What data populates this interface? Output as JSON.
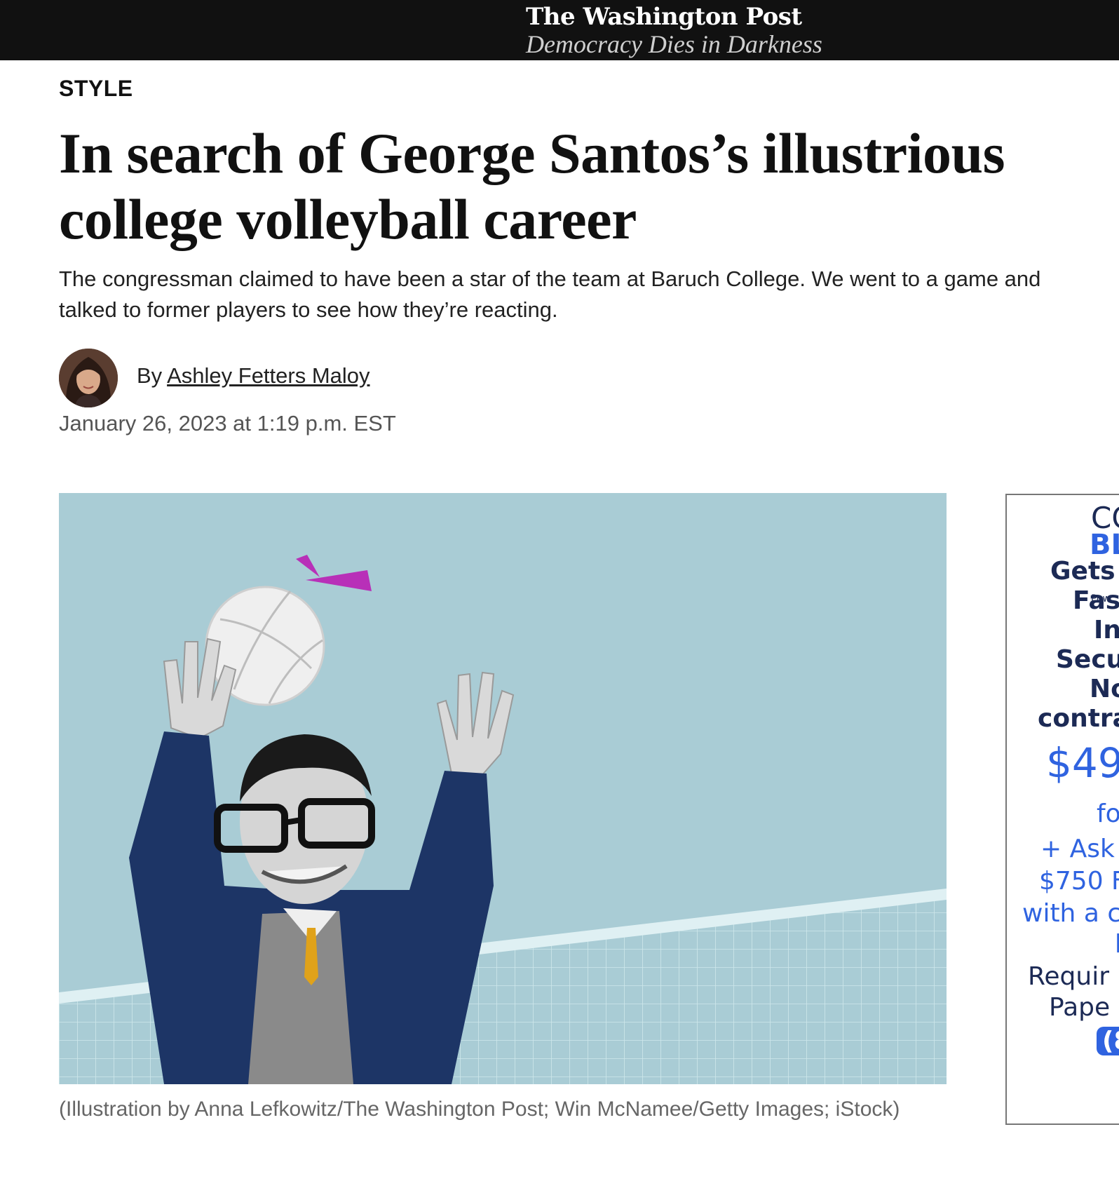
{
  "header": {
    "masthead": "The Washington Post",
    "tagline": "Democracy Dies in Darkness",
    "background_color": "#111111"
  },
  "article": {
    "section": "STYLE",
    "headline_line1": "In search of George Santos’s illustrious",
    "headline_line2": "college volleyball career",
    "dek": "The congressman claimed to have been a star of the team at Baruch College. We went to a game and talked to former players to see how they’re reacting.",
    "byline_prefix": "By",
    "author": "Ashley Fetters Maloy",
    "date": "January 26, 2023 at 1:19 p.m. EST",
    "image_caption": "(Illustration by Anna Lefkowitz/The Washington Post; Win McNamee/Getty Images; iStock)"
  },
  "ad": {
    "lines": [
      "CO",
      "BL",
      "Gets",
      "Pow",
      "Fas",
      "In",
      "Secu",
      "No",
      "contra",
      "$49",
      "fo",
      "+ Ask",
      "$750 F",
      "with a c",
      "b",
      "Requir",
      "Pape",
      "(8"
    ],
    "brand_color": "#2f63e0",
    "text_color": "#1c2a55"
  },
  "colors": {
    "hero_background": "#a9ccd5",
    "accent_magenta": "#b830b8",
    "suit_navy": "#1d3566",
    "tie_gold": "#e0a21a"
  },
  "icons": [
    "author-avatar",
    "volleyball-illustration"
  ]
}
